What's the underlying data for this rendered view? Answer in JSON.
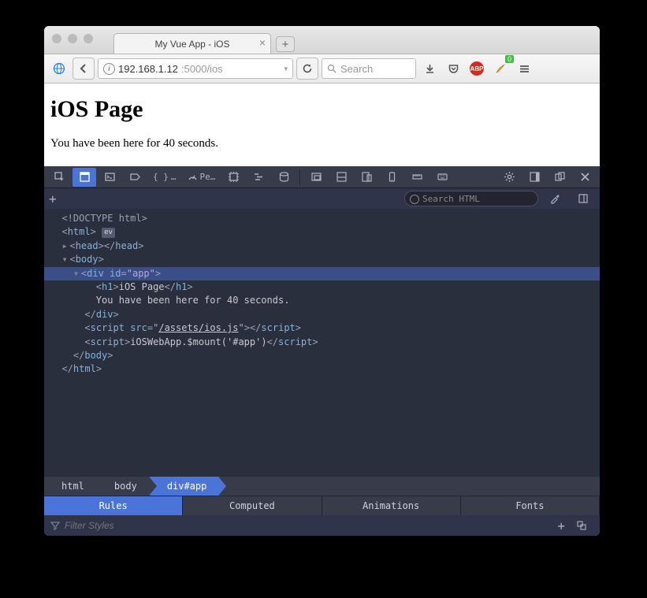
{
  "window": {
    "tab_title": "My Vue App - iOS"
  },
  "toolbar": {
    "url_host": "192.168.1.12",
    "url_path": ":5000/ios",
    "search_placeholder": "Search",
    "gm_badge": "0",
    "abp_label": "ABP"
  },
  "page": {
    "heading": "iOS Page",
    "body_text": "You have been here for 40 seconds."
  },
  "devtools": {
    "perf_label": "Pe…",
    "search_html_placeholder": "Search HTML",
    "dom": {
      "doctype": "<!DOCTYPE html>",
      "html_open_a": "<",
      "html_open_b": "html",
      "html_open_c": ">",
      "ev_label": "ev",
      "head_open": "head",
      "head_close": "head",
      "body_open": "body",
      "div_open_a": "div",
      "div_attr_name": "id",
      "div_attr_val": "\"app\"",
      "h1_open": "h1",
      "h1_text": "iOS Page",
      "h1_close": "h1",
      "text_node": "You have been here for 40 seconds.",
      "div_close": "div",
      "script1_open": "script",
      "script1_attr": "src",
      "script1_val_a": "\"",
      "script1_link": "/assets/ios.js",
      "script1_val_b": "\"",
      "script1_close": "script",
      "script2_open": "script",
      "script2_text": "iOSWebApp.$mount('#app')",
      "script2_close": "script",
      "body_close": "body",
      "html_close": "html"
    },
    "crumbs": [
      "html",
      "body",
      "div#app"
    ],
    "rules_tabs": [
      "Rules",
      "Computed",
      "Animations",
      "Fonts"
    ],
    "filter_placeholder": "Filter Styles"
  }
}
